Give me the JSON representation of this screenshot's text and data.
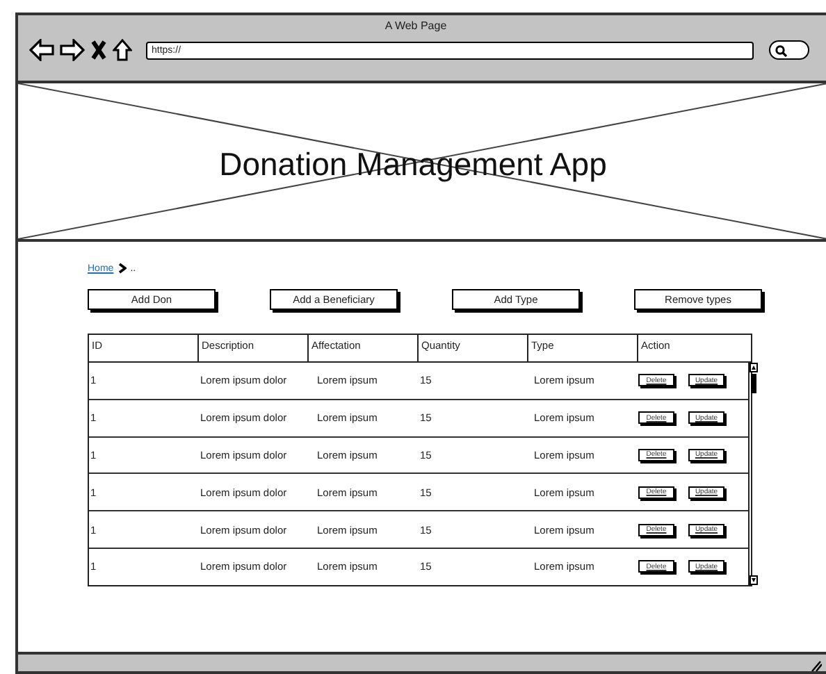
{
  "window": {
    "title": "A Web Page",
    "url": "https://"
  },
  "header": {
    "title": "Donation Management App"
  },
  "breadcrumb": [
    {
      "label": "Home",
      "link": true
    },
    {
      "label": "..",
      "link": false
    }
  ],
  "buttons": [
    "Add Don",
    "Add a Beneficiary",
    "Add Type",
    "Remove types"
  ],
  "table": {
    "columns": [
      "ID",
      "Description",
      "Affectation",
      "Quantity",
      "Type",
      "Action"
    ],
    "rows": [
      {
        "cells": [
          "1",
          "Lorem ipsum dolor",
          "Lorem ipsum",
          "15",
          "Lorem ipsum"
        ],
        "actions": [
          "Delete",
          "Update"
        ]
      },
      {
        "cells": [
          "1",
          "Lorem ipsum dolor",
          "Lorem ipsum",
          "15",
          "Lorem ipsum"
        ],
        "actions": [
          "Delete",
          "Update"
        ]
      },
      {
        "cells": [
          "1",
          "Lorem ipsum dolor",
          "Lorem ipsum",
          "15",
          "Lorem ipsum"
        ],
        "actions": [
          "Delete",
          "Update"
        ]
      },
      {
        "cells": [
          "1",
          "Lorem ipsum dolor",
          "Lorem ipsum",
          "15",
          "Lorem ipsum"
        ],
        "actions": [
          "Delete",
          "Update"
        ]
      },
      {
        "cells": [
          "1",
          "Lorem ipsum dolor",
          "Lorem ipsum",
          "15",
          "Lorem ipsum"
        ],
        "actions": [
          "Delete",
          "Update"
        ]
      },
      {
        "cells": [
          "1",
          "Lorem ipsum dolor",
          "Lorem ipsum",
          "15",
          "Lorem ipsum"
        ],
        "actions": [
          "Delete",
          "Update"
        ]
      }
    ]
  }
}
